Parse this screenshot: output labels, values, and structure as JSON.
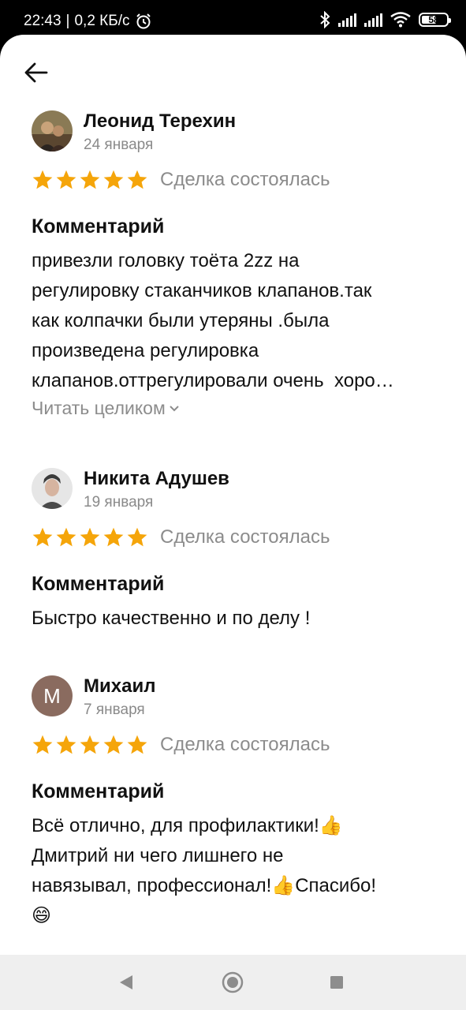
{
  "status_bar": {
    "time": "22:43",
    "separator": "|",
    "speed": "0,2 КБ/с",
    "battery": "58",
    "icons": [
      "alarm-icon",
      "bluetooth-icon",
      "signal-icon",
      "signal-icon",
      "wifi-icon",
      "battery-icon"
    ]
  },
  "header": {
    "back_icon": "arrow-left-icon"
  },
  "reviews": [
    {
      "author": "Леонид Терехин",
      "date": "24 января",
      "rating": 5,
      "status": "Сделка состоялась",
      "comment_label": "Комментарий",
      "lines": [
        "привезли головку тоёта 2zz на",
        "регулировку стаканчиков клапанов.так",
        "как колпачки были утеряны .была",
        "произведена регулировка",
        "клапанов.оттрегулировали очень  хоро…"
      ],
      "read_more": "Читать целиком"
    },
    {
      "author": "Никита Адушев",
      "date": "19 января",
      "rating": 5,
      "status": "Сделка состоялась",
      "comment_label": "Комментарий",
      "lines": [
        "Быстро качественно и по делу !"
      ]
    },
    {
      "author": "Михаил",
      "avatar_letter": "М",
      "avatar_color": "#8a6b5f",
      "date": "7 января",
      "rating": 5,
      "status": "Сделка состоялась",
      "comment_label": "Комментарий",
      "lines": [
        "Всё отлично, для профилактики!",
        "Дмитрий ни чего лишнего не",
        "навязывал, профессионал!",
        "Спасибо!"
      ],
      "emoji_thumb": "👍",
      "emoji_smile": "😄"
    }
  ],
  "colors": {
    "star": "#f5a50a",
    "muted": "#8c8c8c"
  },
  "nav": {
    "icons": [
      "back-triangle-icon",
      "home-circle-icon",
      "recents-square-icon"
    ]
  }
}
